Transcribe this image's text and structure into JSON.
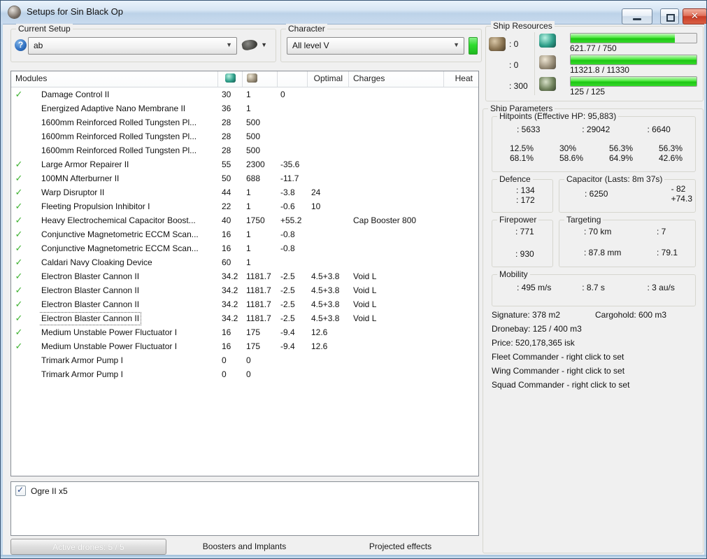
{
  "window": {
    "title": "Setups for Sin Black Op"
  },
  "setup": {
    "group_label": "Current Setup",
    "value": "ab"
  },
  "character": {
    "group_label": "Character",
    "value": "All level V"
  },
  "modules_table": {
    "header": {
      "modules": "Modules",
      "optimal": "Optimal",
      "charges": "Charges",
      "heat": "Heat"
    },
    "header_icons": [
      "cpu",
      "powergrid",
      "capacitor"
    ],
    "rows": [
      {
        "active": true,
        "focused": false,
        "icon": "damage-control",
        "name": "Damage Control II",
        "cpu": "30",
        "pg": "1",
        "cap": "0",
        "optimal": "",
        "charges": ""
      },
      {
        "active": false,
        "focused": false,
        "icon": "nano-membrane",
        "name": "Energized Adaptive Nano Membrane II",
        "cpu": "36",
        "pg": "1",
        "cap": "",
        "optimal": "",
        "charges": ""
      },
      {
        "active": false,
        "focused": false,
        "icon": "armor-plate",
        "name": "1600mm Reinforced Rolled Tungsten Pl...",
        "cpu": "28",
        "pg": "500",
        "cap": "",
        "optimal": "",
        "charges": ""
      },
      {
        "active": false,
        "focused": false,
        "icon": "armor-plate",
        "name": "1600mm Reinforced Rolled Tungsten Pl...",
        "cpu": "28",
        "pg": "500",
        "cap": "",
        "optimal": "",
        "charges": ""
      },
      {
        "active": false,
        "focused": false,
        "icon": "armor-plate",
        "name": "1600mm Reinforced Rolled Tungsten Pl...",
        "cpu": "28",
        "pg": "500",
        "cap": "",
        "optimal": "",
        "charges": ""
      },
      {
        "active": true,
        "focused": false,
        "icon": "armor-repairer",
        "name": "Large Armor Repairer II",
        "cpu": "55",
        "pg": "2300",
        "cap": "-35.6",
        "optimal": "",
        "charges": ""
      },
      {
        "active": true,
        "focused": false,
        "icon": "afterburner",
        "name": "100MN Afterburner II",
        "cpu": "50",
        "pg": "688",
        "cap": "-11.7",
        "optimal": "",
        "charges": ""
      },
      {
        "active": true,
        "focused": false,
        "icon": "warp-disruptor",
        "name": "Warp Disruptor II",
        "cpu": "44",
        "pg": "1",
        "cap": "-3.8",
        "optimal": "24",
        "charges": ""
      },
      {
        "active": true,
        "focused": false,
        "icon": "stasis-web",
        "name": "Fleeting Propulsion Inhibitor I",
        "cpu": "22",
        "pg": "1",
        "cap": "-0.6",
        "optimal": "10",
        "charges": ""
      },
      {
        "active": true,
        "focused": false,
        "icon": "cap-booster",
        "name": "Heavy Electrochemical Capacitor Boost...",
        "cpu": "40",
        "pg": "1750",
        "cap": "+55.2",
        "optimal": "",
        "charges": "Cap Booster 800"
      },
      {
        "active": true,
        "focused": false,
        "icon": "eccm",
        "name": "Conjunctive Magnetometric ECCM Scan...",
        "cpu": "16",
        "pg": "1",
        "cap": "-0.8",
        "optimal": "",
        "charges": ""
      },
      {
        "active": true,
        "focused": false,
        "icon": "eccm",
        "name": "Conjunctive Magnetometric ECCM Scan...",
        "cpu": "16",
        "pg": "1",
        "cap": "-0.8",
        "optimal": "",
        "charges": ""
      },
      {
        "active": true,
        "focused": false,
        "icon": "cloak",
        "name": "Caldari Navy Cloaking Device",
        "cpu": "60",
        "pg": "1",
        "cap": "",
        "optimal": "",
        "charges": ""
      },
      {
        "active": true,
        "focused": false,
        "icon": "blaster",
        "name": "Electron Blaster Cannon II",
        "cpu": "34.2",
        "pg": "1181.7",
        "cap": "-2.5",
        "optimal": "4.5+3.8",
        "charges": "Void L"
      },
      {
        "active": true,
        "focused": false,
        "icon": "blaster",
        "name": "Electron Blaster Cannon II",
        "cpu": "34.2",
        "pg": "1181.7",
        "cap": "-2.5",
        "optimal": "4.5+3.8",
        "charges": "Void L"
      },
      {
        "active": true,
        "focused": false,
        "icon": "blaster",
        "name": "Electron Blaster Cannon II",
        "cpu": "34.2",
        "pg": "1181.7",
        "cap": "-2.5",
        "optimal": "4.5+3.8",
        "charges": "Void L"
      },
      {
        "active": true,
        "focused": true,
        "icon": "blaster",
        "name": "Electron Blaster Cannon II",
        "cpu": "34.2",
        "pg": "1181.7",
        "cap": "-2.5",
        "optimal": "4.5+3.8",
        "charges": "Void L"
      },
      {
        "active": true,
        "focused": false,
        "icon": "smartbomb",
        "name": "Medium Unstable Power Fluctuator I",
        "cpu": "16",
        "pg": "175",
        "cap": "-9.4",
        "optimal": "12.6",
        "charges": ""
      },
      {
        "active": true,
        "focused": false,
        "icon": "smartbomb",
        "name": "Medium Unstable Power Fluctuator I",
        "cpu": "16",
        "pg": "175",
        "cap": "-9.4",
        "optimal": "12.6",
        "charges": ""
      },
      {
        "active": false,
        "focused": false,
        "icon": "rig",
        "name": "Trimark Armor Pump I",
        "cpu": "0",
        "pg": "0",
        "cap": "",
        "optimal": "",
        "charges": ""
      },
      {
        "active": false,
        "focused": false,
        "icon": "rig",
        "name": "Trimark Armor Pump I",
        "cpu": "0",
        "pg": "0",
        "cap": "",
        "optimal": "",
        "charges": ""
      }
    ]
  },
  "drones": {
    "items": [
      {
        "checked": true,
        "label": "Ogre II x5"
      }
    ]
  },
  "tabs": [
    {
      "label": "Active drones: 5 / 5",
      "active": true
    },
    {
      "label": "Boosters and Implants",
      "active": false
    },
    {
      "label": "Projected effects",
      "active": false
    }
  ],
  "ship_resources": {
    "group_label": "Ship Resources",
    "hardpoints": [
      {
        "icon": "turret-hardpoint",
        "value": ": 0"
      },
      {
        "icon": "launcher-hardpoint",
        "value": ": 0"
      },
      {
        "icon": "calibration",
        "value": ": 300"
      }
    ],
    "bars": [
      {
        "icon": "cpu",
        "text": "621.77 / 750",
        "percent": 83
      },
      {
        "icon": "powergrid",
        "text": "11321.8 / 11330",
        "percent": 99.9
      },
      {
        "icon": "drone-bandwidth",
        "text": "125 / 125",
        "percent": 100
      }
    ]
  },
  "ship_parameters": {
    "label": "Ship Parameters",
    "hitpoints": {
      "label": "Hitpoints (Effective HP: 95,883)",
      "stats": [
        {
          "icon": "shield",
          "value": ": 5633"
        },
        {
          "icon": "armor",
          "value": ": 29042"
        },
        {
          "icon": "structure",
          "value": ": 6640"
        }
      ],
      "resists": [
        {
          "icon": "em-resist",
          "top": "12.5%",
          "bottom": "68.1%"
        },
        {
          "icon": "thermal-resist",
          "top": "30%",
          "bottom": "58.6%"
        },
        {
          "icon": "kinetic-resist",
          "top": "56.3%",
          "bottom": "64.9%"
        },
        {
          "icon": "explosive-resist",
          "top": "56.3%",
          "bottom": "42.6%"
        }
      ]
    },
    "defence": {
      "label": "Defence",
      "value_top": ": 134",
      "value_bottom": ": 172"
    },
    "capacitor": {
      "label": "Capacitor (Lasts: 8m 37s)",
      "amount": ": 6250",
      "delta_top": "- 82",
      "delta_bottom": "+74.3"
    },
    "firepower": {
      "label": "Firepower",
      "stats": [
        {
          "icon": "turret-dps",
          "value": ": 771"
        },
        {
          "icon": "volley",
          "value": ": 930"
        }
      ]
    },
    "targeting": {
      "label": "Targeting",
      "stats": [
        {
          "icon": "targeting-range",
          "value": ": 70 km"
        },
        {
          "icon": "max-targets",
          "value": ": 7"
        },
        {
          "icon": "scan-resolution",
          "value": ": 87.8 mm"
        },
        {
          "icon": "sensor-strength",
          "value": ": 79.1"
        }
      ]
    },
    "mobility": {
      "label": "Mobility",
      "stats": [
        {
          "icon": "max-velocity",
          "value": ": 495 m/s"
        },
        {
          "icon": "align-time",
          "value": ": 8.7 s"
        },
        {
          "icon": "warp-speed",
          "value": ": 3 au/s"
        }
      ]
    },
    "info": {
      "signature": "Signature: 378 m2",
      "cargohold": "Cargohold: 600 m3",
      "lines": [
        "Dronebay: 125 / 400 m3",
        "Price: 520,178,365 isk",
        "Fleet Commander - right click to set",
        "Wing Commander - right click to set",
        "Squad Commander - right click to set"
      ]
    }
  },
  "colors": {
    "bar_green": "#35d92a",
    "check_green": "#3cb22e",
    "close_red": "#c93d27",
    "titlebar_blue": "#c9dbee",
    "ready_indicator_green": "#2fdc2f"
  }
}
